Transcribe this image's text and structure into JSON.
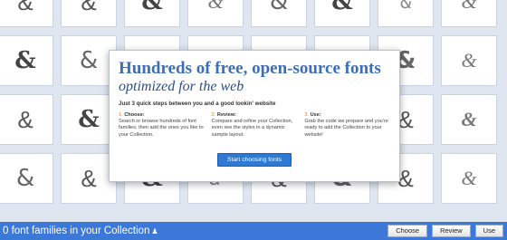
{
  "background": {
    "tile_glyph": "&",
    "tile_count": 32
  },
  "intro": {
    "headline": "Hundreds of free, open-source fonts",
    "subheadline": "optimized for the web",
    "tagline": "Just 3 quick steps between you and a good lookin' website",
    "steps": [
      {
        "number": "1.",
        "title": "Choose:",
        "text": "Search or browse hundreds of font families, then add the ones you like to your Collection."
      },
      {
        "number": "2.",
        "title": "Review:",
        "text": "Compare and refine your Collection, even see the styles in a dynamic sample layout."
      },
      {
        "number": "3.",
        "title": "Use:",
        "text": "Grab the code we prepare and you're ready to add the Collection to your website!"
      }
    ],
    "cta_label": "Start choosing fonts"
  },
  "bottom_bar": {
    "collection_count_text": "0 font families in your Collection",
    "icon": "person-icon",
    "buttons": {
      "choose": "Choose",
      "review": "Review",
      "use": "Use"
    }
  },
  "colors": {
    "accent": "#3b78d8",
    "headline": "#3d6fb6",
    "cta": "#2d79d3"
  }
}
